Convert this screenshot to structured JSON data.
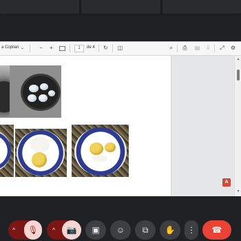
{
  "viewer": {
    "doc_title_fragment": "a Copilari",
    "chevron": "⌄",
    "zoom_out": "−",
    "zoom_in": "+",
    "page_current": "1",
    "page_of": "de 4",
    "pdf_badge": "A"
  },
  "images": [
    {
      "name": "boiling-eggs-pan-left"
    },
    {
      "name": "boiling-eggs-pan"
    },
    {
      "name": "plate-eggs-left"
    },
    {
      "name": "plate-egg-white"
    },
    {
      "name": "plate-egg-yolks"
    }
  ],
  "controls": {
    "mic": "🎙",
    "camera": "📷",
    "present": "▣",
    "emoji": "☺",
    "captions": "⧉",
    "hand": "✋",
    "more": "⋮",
    "end": "☎",
    "chevron_up": "^"
  },
  "colors": {
    "background": "#202124",
    "end_call": "#ea4335",
    "muted_accent": "#f6d6d3"
  }
}
